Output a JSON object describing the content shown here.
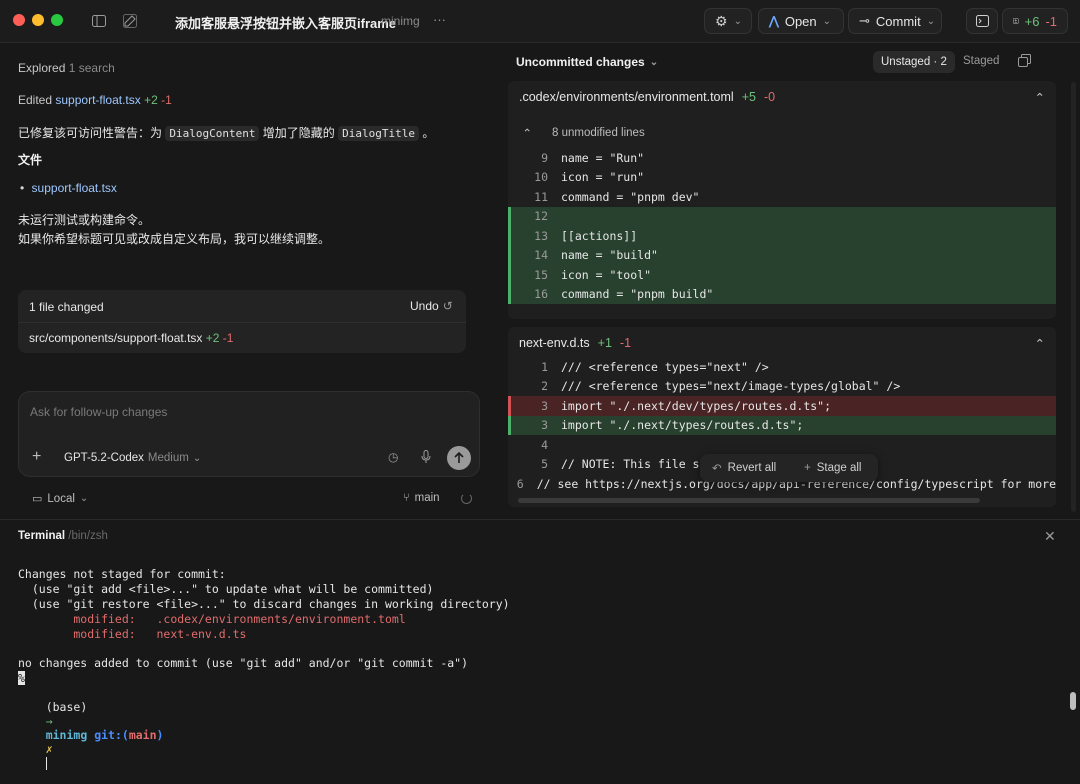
{
  "titlebar": {
    "title": "添加客服悬浮按钮并嵌入客服页iframe",
    "project": "minimg",
    "more": "···",
    "open_label": "Open",
    "commit_label": "Commit",
    "diff_plus": "+6",
    "diff_minus": "-1"
  },
  "chat": {
    "explored_label": "Explored",
    "explored_count": "1 search",
    "edited_label": "Edited",
    "edited_file": "support-float.tsx",
    "edited_plus": "+2",
    "edited_minus": "-1",
    "msg_prefix": "已修复该可访问性警告：为",
    "msg_code1": "DialogContent",
    "msg_middle": "增加了隐藏的",
    "msg_code2": "DialogTitle",
    "msg_suffix": "。",
    "files_heading": "文件",
    "file_item": "support-float.tsx",
    "note1": "未运行测试或构建命令。",
    "note2": "如果你希望标题可见或改成自定义布局，我可以继续调整。",
    "changes_card": {
      "title": "1 file changed",
      "undo_label": "Undo",
      "path": "src/components/support-float.tsx",
      "plus": "+2",
      "minus": "-1"
    },
    "composer": {
      "placeholder": "Ask for follow-up changes",
      "model": "GPT-5.2-Codex",
      "effort": "Medium"
    },
    "footer": {
      "local_label": "Local",
      "branch": "main"
    }
  },
  "diff": {
    "header_title": "Uncommitted changes",
    "tab_unstaged": "Unstaged · 2",
    "tab_staged": "Staged",
    "file1": {
      "name": ".codex/environments/environment.toml",
      "plus": "+5",
      "minus": "-0",
      "unmodified": "8 unmodified lines",
      "lines": [
        {
          "n": "9",
          "t": "name = \"Run\"",
          "kind": "ctx"
        },
        {
          "n": "10",
          "t": "icon = \"run\"",
          "kind": "ctx"
        },
        {
          "n": "11",
          "t": "command = \"pnpm dev\"",
          "kind": "ctx"
        },
        {
          "n": "12",
          "t": "",
          "kind": "add"
        },
        {
          "n": "13",
          "t": "[[actions]]",
          "kind": "add"
        },
        {
          "n": "14",
          "t": "name = \"build\"",
          "kind": "add"
        },
        {
          "n": "15",
          "t": "icon = \"tool\"",
          "kind": "add"
        },
        {
          "n": "16",
          "t": "command = \"pnpm build\"",
          "kind": "add"
        }
      ]
    },
    "file2": {
      "name": "next-env.d.ts",
      "plus": "+1",
      "minus": "-1",
      "lines": [
        {
          "n": "1",
          "t": "/// <reference types=\"next\" />",
          "kind": "ctx"
        },
        {
          "n": "2",
          "t": "/// <reference types=\"next/image-types/global\" />",
          "kind": "ctx"
        },
        {
          "n": "3",
          "t": "import \"./.next/dev/types/routes.d.ts\";",
          "kind": "del"
        },
        {
          "n": "3",
          "t": "import \"./.next/types/routes.d.ts\";",
          "kind": "add"
        },
        {
          "n": "4",
          "t": "",
          "kind": "ctx"
        },
        {
          "n": "5",
          "t": "// NOTE: This file sh",
          "kind": "ctx"
        },
        {
          "n": "6",
          "t": "// see https://nextjs.org/docs/app/api-reference/config/typescript for more",
          "kind": "ctx"
        }
      ]
    },
    "revert_all": "Revert all",
    "stage_all": "Stage all"
  },
  "terminal": {
    "title": "Terminal",
    "shell": "/bin/zsh",
    "lines": [
      "Changes not staged for commit:",
      "  (use \"git add <file>...\" to update what will be committed)",
      "  (use \"git restore <file>...\" to discard changes in working directory)"
    ],
    "modified": [
      "        modified:   .codex/environments/environment.toml",
      "        modified:   next-env.d.ts"
    ],
    "no_changes": "no changes added to commit (use \"git add\" and/or \"git commit -a\")",
    "cursor_glyph": "%",
    "prompt_env": "(base)",
    "prompt_arrow": "→",
    "prompt_dir": "minimg",
    "prompt_git": "git:(",
    "prompt_branch": "main",
    "prompt_git_close": ")",
    "prompt_x": "✗"
  },
  "colors": {
    "accent_blue": "#9ec7ff",
    "add_green": "#6fc27c",
    "del_red": "#e06c6c",
    "add_bg": "#27412e",
    "del_bg": "#4a2424"
  }
}
